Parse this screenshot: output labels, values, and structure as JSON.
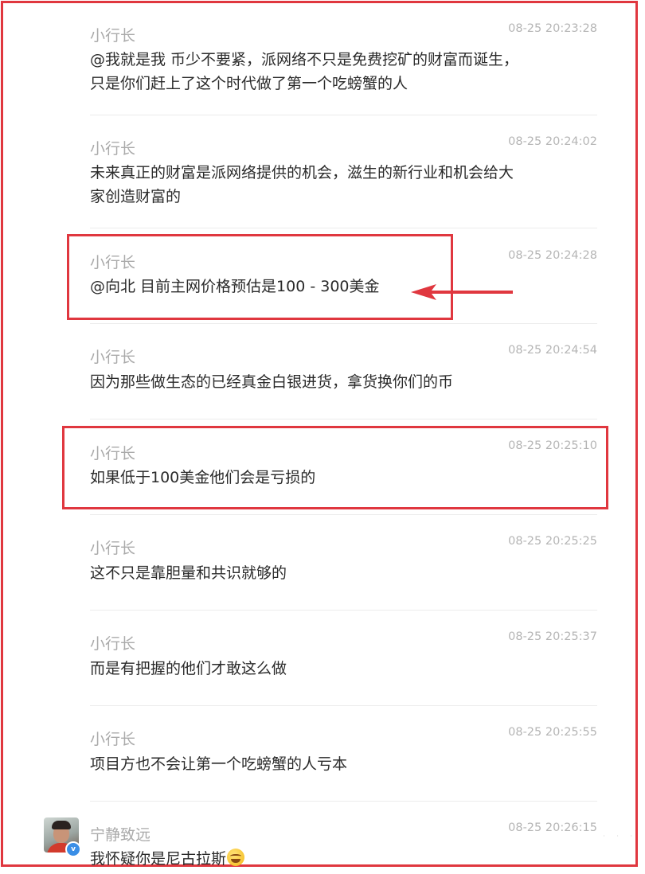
{
  "comments": [
    {
      "author": "小行长",
      "time": "08-25 20:23:28",
      "text_line1": "@我就是我 币少不要紧，派网络不只是免费挖矿的财富而诞生，",
      "text_line2": "只是你们赶上了这个时代做了第一个吃螃蟹的人"
    },
    {
      "author": "小行长",
      "time": "08-25 20:24:02",
      "text_line1": "未来真正的财富是派网络提供的机会，滋生的新行业和机会给大",
      "text_line2": "家创造财富的"
    },
    {
      "author": "小行长",
      "time": "08-25 20:24:28",
      "text_line1": "@向北 目前主网价格预估是100 - 300美金",
      "highlighted": true,
      "arrow": true
    },
    {
      "author": "小行长",
      "time": "08-25 20:24:54",
      "text_line1": "因为那些做生态的已经真金白银进货，拿货换你们的币"
    },
    {
      "author": "小行长",
      "time": "08-25 20:25:10",
      "text_line1": "如果低于100美金他们会是亏损的",
      "highlighted": true
    },
    {
      "author": "小行长",
      "time": "08-25 20:25:25",
      "text_line1": "这不只是靠胆量和共识就够的"
    },
    {
      "author": "小行长",
      "time": "08-25 20:25:37",
      "text_line1": "而是有把握的他们才敢这么做"
    },
    {
      "author": "小行长",
      "time": "08-25 20:25:55",
      "text_line1": "项目方也不会让第一个吃螃蟹的人亏本"
    },
    {
      "author": "宁静致远",
      "time": "08-25 20:26:15",
      "text_line1": "我怀疑你是尼古拉斯",
      "emoji": "grinning-sweat-emoji",
      "has_avatar": true,
      "badge": "v"
    }
  ],
  "colors": {
    "highlight": "#e0373f",
    "author": "#aaaaaa",
    "time": "#b5b5b5",
    "text": "#2a2a2a",
    "divider": "#ececec",
    "badge": "#3a8ee6"
  }
}
